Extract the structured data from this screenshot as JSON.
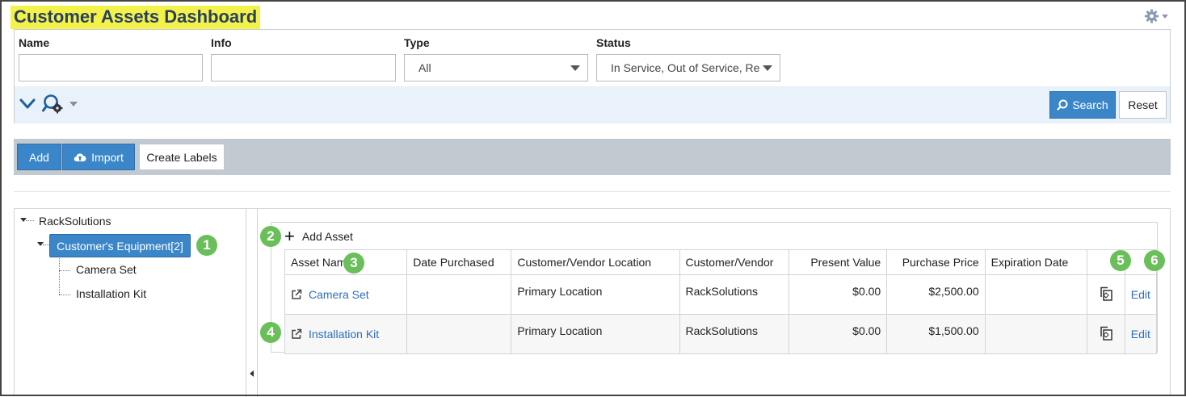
{
  "page": {
    "title": "Customer Assets Dashboard",
    "settings_icon": "gear-icon"
  },
  "filters": {
    "name_label": "Name",
    "info_label": "Info",
    "type_label": "Type",
    "status_label": "Status",
    "name_value": "",
    "info_value": "",
    "type_value": "All",
    "status_value": "In Service, Out of Service, Re",
    "search_label": "Search",
    "reset_label": "Reset"
  },
  "toolbar": {
    "add_label": "Add",
    "import_label": "Import",
    "create_labels_label": "Create Labels"
  },
  "tree": {
    "root": "RackSolutions",
    "selected": "Customer's Equipment[2]",
    "children": [
      "Camera Set",
      "Installation Kit"
    ]
  },
  "grid": {
    "add_asset_label": "Add Asset",
    "columns": [
      "Asset Name",
      "Date Purchased",
      "Customer/Vendor Location",
      "Customer/Vendor",
      "Present Value",
      "Purchase Price",
      "Expiration Date"
    ],
    "rows": [
      {
        "asset_name": "Camera Set",
        "date_purchased": "",
        "location": "Primary Location",
        "vendor": "RackSolutions",
        "present_value": "$0.00",
        "purchase_price": "$2,500.00",
        "expiration_date": "",
        "edit": "Edit"
      },
      {
        "asset_name": "Installation Kit",
        "date_purchased": "",
        "location": "Primary Location",
        "vendor": "RackSolutions",
        "present_value": "$0.00",
        "purchase_price": "$1,500.00",
        "expiration_date": "",
        "edit": "Edit"
      }
    ]
  },
  "callouts": [
    "1",
    "2",
    "3",
    "4",
    "5",
    "6"
  ],
  "colors": {
    "accent": "#3b86c9",
    "title_highlight": "#f2f24a",
    "callout": "#6abf5a",
    "toolbar_bg": "#c1c9d1"
  }
}
